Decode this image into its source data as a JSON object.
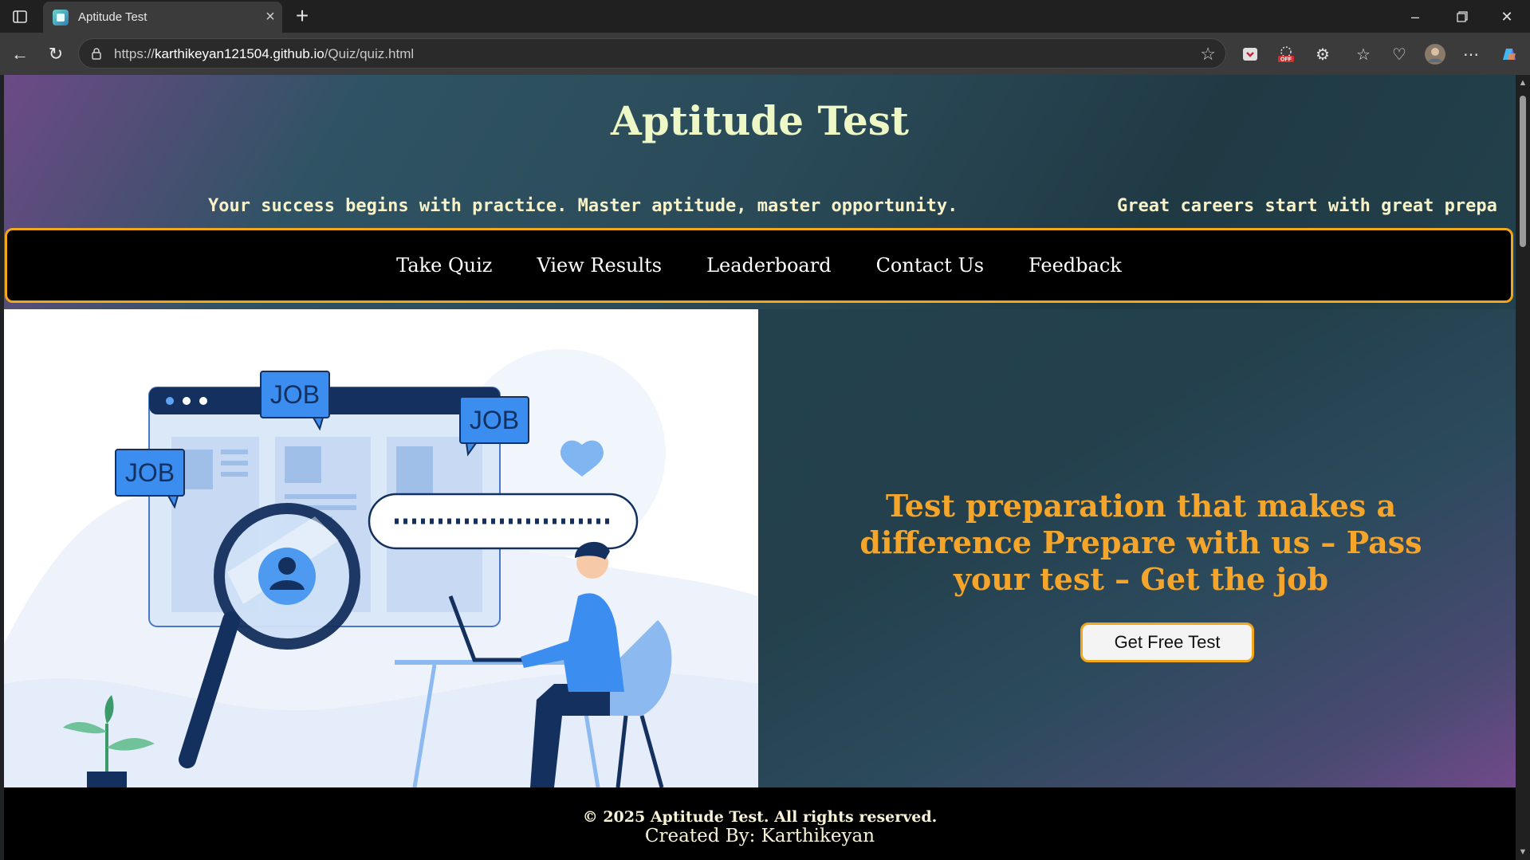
{
  "browser": {
    "tab_title": "Aptitude Test",
    "url_scheme": "https://",
    "url_host": "karthikeyan121504.github.io",
    "url_path": "/Quiz/quiz.html",
    "extension_off_badge": "OFF"
  },
  "header": {
    "title": "Aptitude Test",
    "marquee_1": "Your success begins with practice. Master aptitude, master opportunity.",
    "marquee_2": "Great careers start with great prepa"
  },
  "nav": {
    "items": [
      "Take Quiz",
      "View Results",
      "Leaderboard",
      "Contact Us",
      "Feedback"
    ]
  },
  "illustration": {
    "badges": [
      "JOB",
      "JOB",
      "JOB"
    ]
  },
  "promo": {
    "headline": "Test preparation that makes a difference Prepare with us – Pass your test – Get the job",
    "cta_label": "Get Free Test"
  },
  "footer": {
    "copyright": "© 2025 Aptitude Test. All rights reserved.",
    "created_by": "Created By: Karthikeyan"
  },
  "colors": {
    "accent_orange": "#f2a71b",
    "headline_orange": "#f4a52a",
    "title_cream": "#eef8c6",
    "job_blue": "#3b8ef0",
    "navy": "#14305e"
  }
}
